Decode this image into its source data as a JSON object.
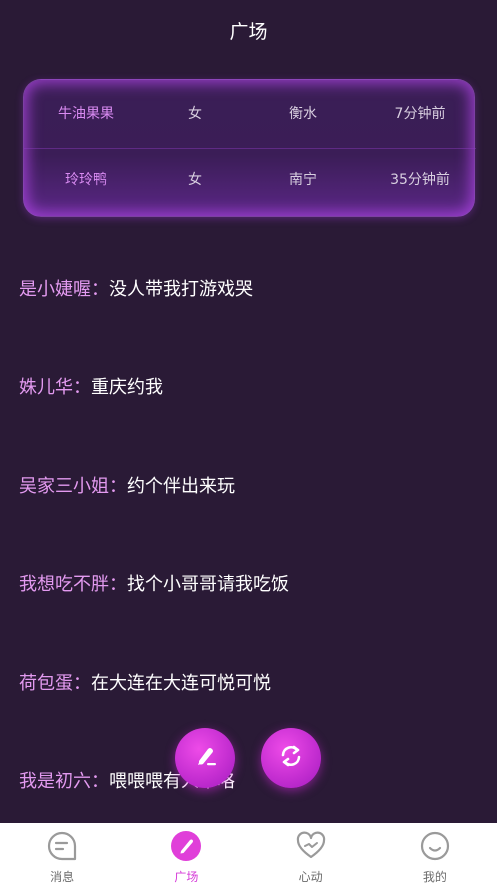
{
  "header": {
    "title": "广场"
  },
  "recent_card": {
    "rows": [
      {
        "name": "牛油果果",
        "gender": "女",
        "city": "衡水",
        "time": "7分钟前"
      },
      {
        "name": "玲玲鸭",
        "gender": "女",
        "city": "南宁",
        "time": "35分钟前"
      }
    ]
  },
  "feed": {
    "items": [
      {
        "nick": "是小婕喔",
        "colon": "：",
        "msg": "没人带我打游戏哭"
      },
      {
        "nick": "姝儿华",
        "colon": "：",
        "msg": "重庆约我"
      },
      {
        "nick": "吴家三小姐",
        "colon": "：",
        "msg": "约个伴出来玩"
      },
      {
        "nick": "我想吃不胖",
        "colon": "：",
        "msg": "找个小哥哥请我吃饭"
      },
      {
        "nick": "荷包蛋",
        "colon": "：",
        "msg": "在大连在大连可悦可悦"
      },
      {
        "nick": "我是初六",
        "colon": "：",
        "msg": "喂喂喂有人不咯"
      }
    ]
  },
  "fabs": {
    "edit_icon": "edit-pen-icon",
    "refresh_icon": "refresh-icon"
  },
  "tabbar": {
    "tabs": [
      {
        "label": "消息",
        "icon": "message-icon",
        "active": false
      },
      {
        "label": "广场",
        "icon": "square-pen-icon",
        "active": true
      },
      {
        "label": "心动",
        "icon": "heart-icon",
        "active": false
      },
      {
        "label": "我的",
        "icon": "smile-icon",
        "active": false
      }
    ]
  },
  "colors": {
    "background": "#2a1a36",
    "accent": "#d63bd8",
    "nickname": "#e39af0",
    "card_glow": "#b046e6"
  }
}
